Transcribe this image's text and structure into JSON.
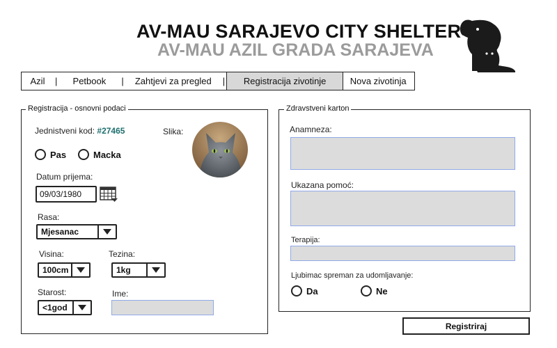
{
  "header": {
    "title_en": "AV-MAU SARAJEVO CITY SHELTER",
    "title_bs": "AV-MAU AZIL GRADA SARAJEVA"
  },
  "nav": {
    "items": [
      "Azil",
      "Petbook",
      "Zahtjevi za pregled",
      "Registracija zivotinje",
      "Nova zivotinja"
    ],
    "separator": "|",
    "active": "Registracija zivotinje"
  },
  "basic": {
    "legend": "Registracija - osnovni podaci",
    "unique_code_label": "Jednistveni kod:",
    "unique_code": "#27465",
    "photo_label": "Slika:",
    "species_options": [
      "Pas",
      "Macka"
    ],
    "date_label": "Datum prijema:",
    "date_value": "09/03/1980",
    "breed_label": "Rasa:",
    "breed_value": "Mjesanac",
    "height_label": "Visina:",
    "height_value": "100cm",
    "weight_label": "Tezina:",
    "weight_value": "1kg",
    "age_label": "Starost:",
    "age_value": "<1god",
    "name_label": "Ime:",
    "name_value": ""
  },
  "health": {
    "legend": "Zdravstveni karton",
    "anamnesis_label": "Anamneza:",
    "help_label": "Ukazana pomoć:",
    "therapy_label": "Terapija:",
    "adoption_label": "Ljubimac spreman za udomljavanje:",
    "adoption_options": [
      "Da",
      "Ne"
    ]
  },
  "actions": {
    "register": "Registriraj"
  },
  "colors": {
    "code": "#1f6f6f",
    "field_bg": "#dcdcdc",
    "field_border": "#8fa9e8",
    "subtitle": "#9b9b9b",
    "nav_active": "#d8d8d8"
  },
  "icons": {
    "logo": "dog-cat-logo-icon",
    "calendar": "calendar-icon",
    "dropdown": "chevron-down-icon"
  }
}
